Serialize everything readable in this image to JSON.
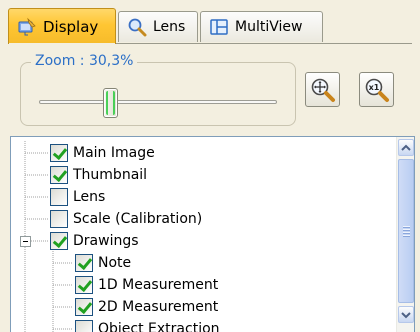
{
  "tabs": [
    {
      "label": "Display",
      "icon": "display-icon",
      "active": true
    },
    {
      "label": "Lens",
      "icon": "magnifier-icon",
      "active": false
    },
    {
      "label": "MultiView",
      "icon": "multiview-icon",
      "active": false
    }
  ],
  "zoom": {
    "label": "Zoom : 30,3%",
    "slider_value": 0.3
  },
  "buttons": {
    "fit": {
      "icon": "zoom-fit-icon"
    },
    "actual_size": {
      "icon": "zoom-x1-icon",
      "text": "x1"
    }
  },
  "tree": {
    "items": [
      {
        "label": "Main Image",
        "checked": true
      },
      {
        "label": "Thumbnail",
        "checked": true
      },
      {
        "label": "Lens",
        "checked": false
      },
      {
        "label": "Scale (Calibration)",
        "checked": false
      },
      {
        "label": "Drawings",
        "checked": true,
        "expanded": true
      },
      {
        "label": "Note",
        "checked": true
      },
      {
        "label": "1D Measurement",
        "checked": true
      },
      {
        "label": "2D Measurement",
        "checked": true
      },
      {
        "label": "Object Extraction",
        "checked": false
      }
    ]
  },
  "colors": {
    "active_tab": "#ffc633",
    "zoom_label": "#2b6fc7",
    "check": "#21a121"
  }
}
